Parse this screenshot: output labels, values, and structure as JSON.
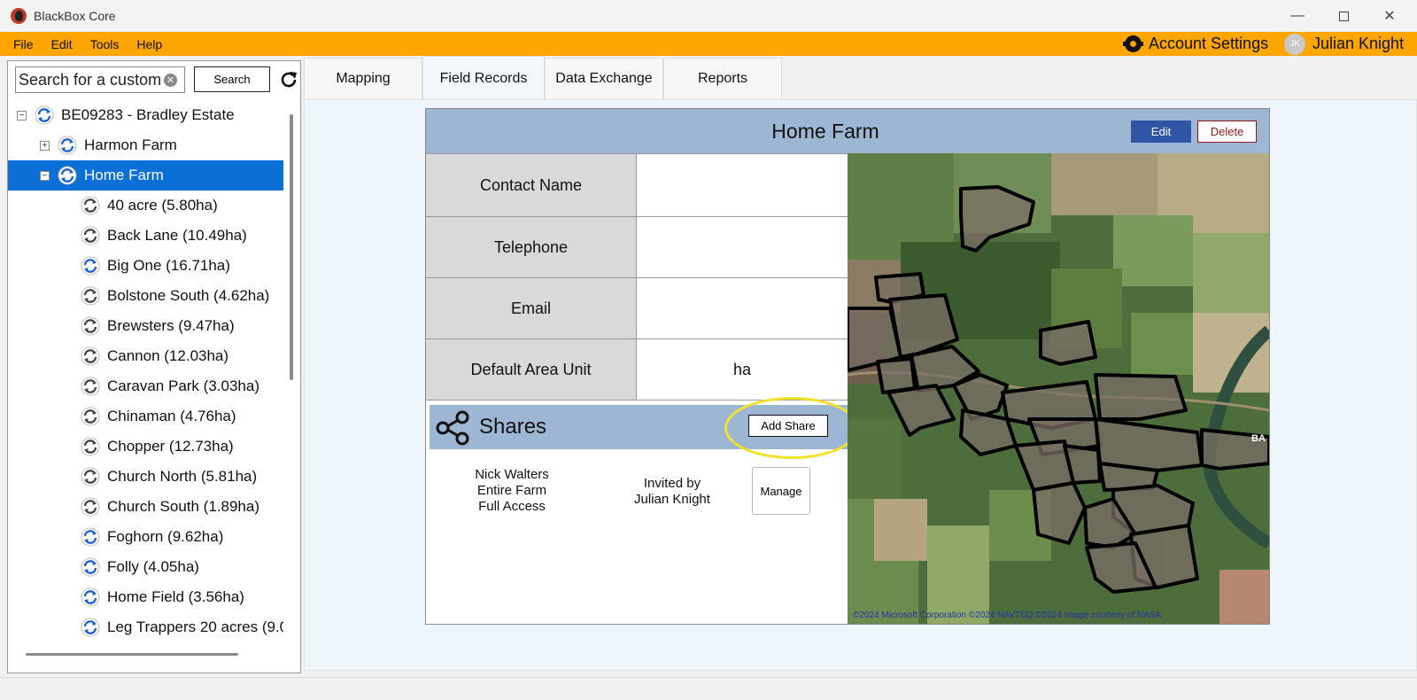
{
  "window": {
    "title": "BlackBox Core"
  },
  "menu": {
    "items": [
      "File",
      "Edit",
      "Tools",
      "Help"
    ]
  },
  "account": {
    "settings_label": "Account Settings",
    "user_initials": "JK",
    "user_name": "Julian Knight"
  },
  "search": {
    "value": "Search for a customer",
    "button_label": "Search"
  },
  "tree": {
    "root": {
      "label": "BE09283 - Bradley Estate",
      "expander": "⊟"
    },
    "farms": [
      {
        "label": "Harmon Farm",
        "expander": "⊞"
      },
      {
        "label": "Home Farm",
        "expander": "⊟",
        "selected": true
      }
    ],
    "fields": [
      {
        "label": "40 acre (5.80ha)",
        "synced": false
      },
      {
        "label": "Back Lane (10.49ha)",
        "synced": false
      },
      {
        "label": "Big One (16.71ha)",
        "synced": true
      },
      {
        "label": "Bolstone South (4.62ha)",
        "synced": false
      },
      {
        "label": "Brewsters (9.47ha)",
        "synced": false
      },
      {
        "label": "Cannon (12.03ha)",
        "synced": false
      },
      {
        "label": "Caravan Park (3.03ha)",
        "synced": false
      },
      {
        "label": "Chinaman (4.76ha)",
        "synced": false
      },
      {
        "label": "Chopper (12.73ha)",
        "synced": false
      },
      {
        "label": "Church North (5.81ha)",
        "synced": false
      },
      {
        "label": "Church South (1.89ha)",
        "synced": false
      },
      {
        "label": "Foghorn (9.62ha)",
        "synced": true
      },
      {
        "label": "Folly (4.05ha)",
        "synced": true
      },
      {
        "label": "Home Field (3.56ha)",
        "synced": true
      },
      {
        "label": "Leg Trappers 20 acres (9.0",
        "synced": true
      }
    ]
  },
  "tabs": [
    {
      "label": "Mapping",
      "active": false
    },
    {
      "label": "Field Records",
      "active": true
    },
    {
      "label": "Data Exchange",
      "active": false
    },
    {
      "label": "Reports",
      "active": false
    }
  ],
  "record": {
    "title": "Home Farm",
    "edit_label": "Edit",
    "delete_label": "Delete",
    "fields": [
      {
        "label": "Contact Name",
        "value": ""
      },
      {
        "label": "Telephone",
        "value": ""
      },
      {
        "label": "Email",
        "value": ""
      },
      {
        "label": "Default Area Unit",
        "value": "ha"
      }
    ],
    "shares": {
      "title": "Shares",
      "add_label": "Add Share",
      "entries": [
        {
          "who": [
            "Nick Walters",
            "Entire Farm",
            "Full Access"
          ],
          "inviter": [
            "Invited by",
            "Julian Knight"
          ],
          "manage_label": "Manage"
        }
      ]
    },
    "map": {
      "attribution": "©2024 Microsoft Corporation  ©2024 NAVTEQ  ©2024 Image courtesy of NASA",
      "place_label": "BA"
    }
  },
  "colors": {
    "menubar": "#ffa500",
    "selection": "#0a70d8",
    "header": "#9db6d4",
    "edit": "#2f55a4",
    "highlight": "#f2e22a"
  }
}
